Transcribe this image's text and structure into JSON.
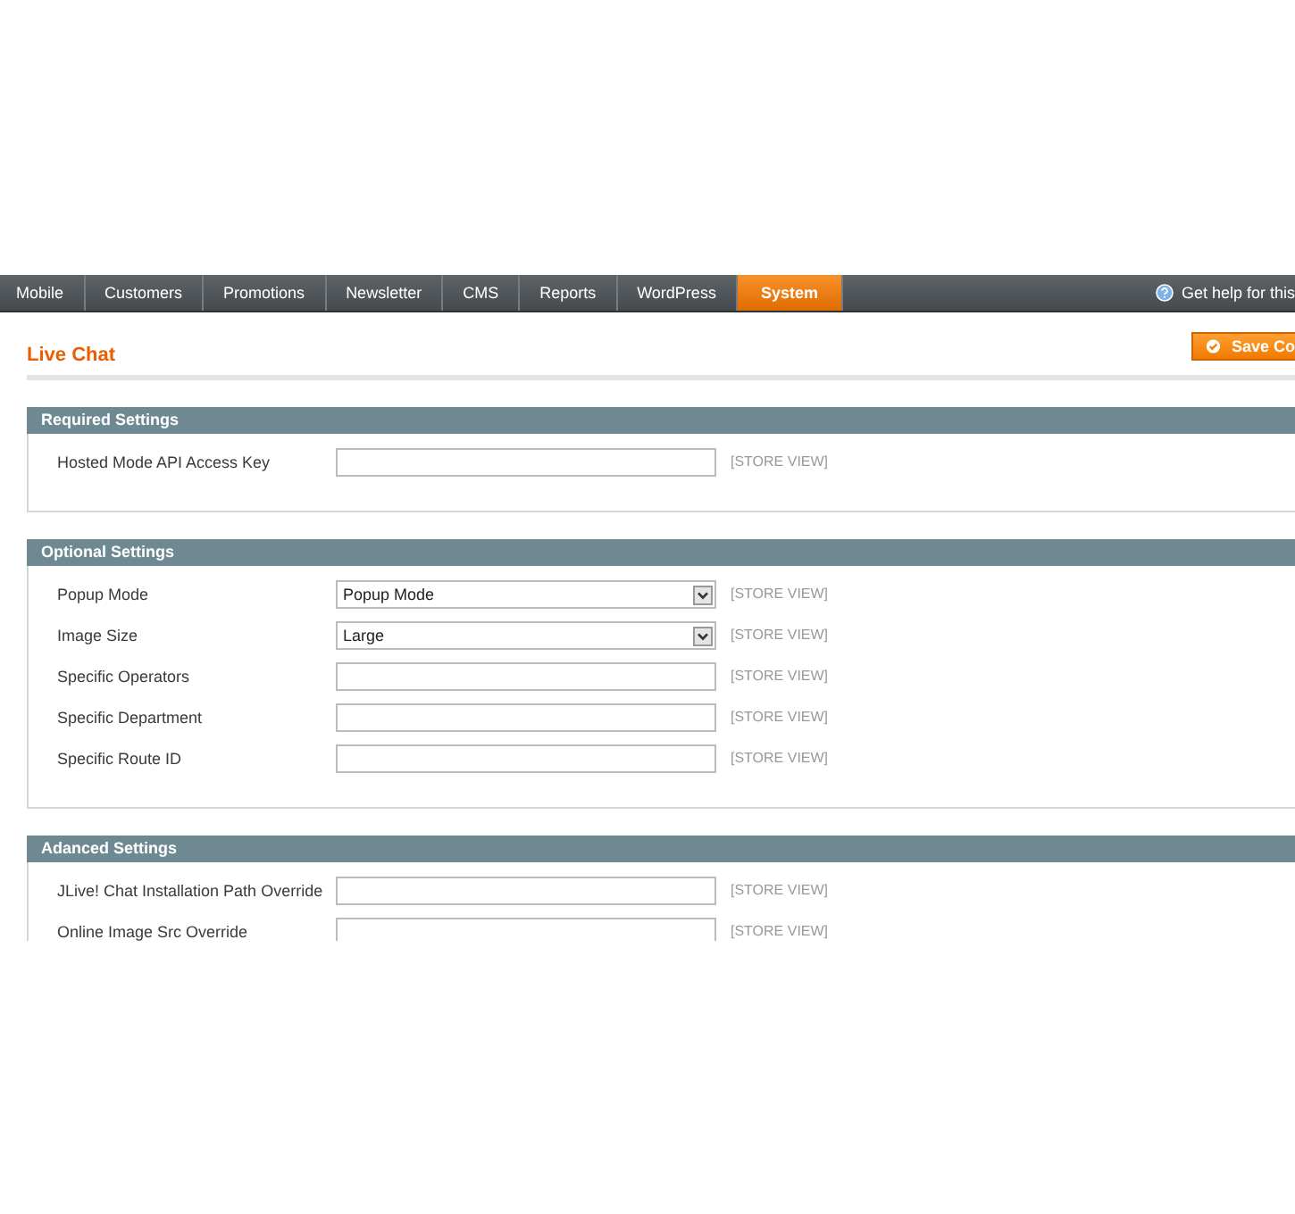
{
  "nav": {
    "tabs": [
      {
        "label": "Mobile",
        "selected": false
      },
      {
        "label": "Customers",
        "selected": false
      },
      {
        "label": "Promotions",
        "selected": false
      },
      {
        "label": "Newsletter",
        "selected": false
      },
      {
        "label": "CMS",
        "selected": false
      },
      {
        "label": "Reports",
        "selected": false
      },
      {
        "label": "WordPress",
        "selected": false
      },
      {
        "label": "System",
        "selected": true
      }
    ],
    "help": "Get help for this"
  },
  "page": {
    "title": "Live Chat",
    "save_button": "Save Co"
  },
  "sections": [
    {
      "title": "Required Settings",
      "fields": [
        {
          "kind": "text",
          "label": "Hosted Mode API Access Key",
          "scope": "[STORE VIEW]"
        }
      ]
    },
    {
      "title": "Optional Settings",
      "fields": [
        {
          "kind": "select",
          "label": "Popup Mode",
          "value": "Popup Mode",
          "scope": "[STORE VIEW]"
        },
        {
          "kind": "select",
          "label": "Image Size",
          "value": "Large",
          "scope": "[STORE VIEW]"
        },
        {
          "kind": "text",
          "label": "Specific Operators",
          "scope": "[STORE VIEW]"
        },
        {
          "kind": "text",
          "label": "Specific Department",
          "scope": "[STORE VIEW]"
        },
        {
          "kind": "text",
          "label": "Specific Route ID",
          "scope": "[STORE VIEW]"
        }
      ]
    },
    {
      "title": "Adanced Settings",
      "fields": [
        {
          "kind": "text",
          "label": "JLive! Chat Installation Path Override",
          "scope": "[STORE VIEW]"
        },
        {
          "kind": "text",
          "label": "Online Image Src Override",
          "scope": "[STORE VIEW]"
        }
      ]
    }
  ]
}
